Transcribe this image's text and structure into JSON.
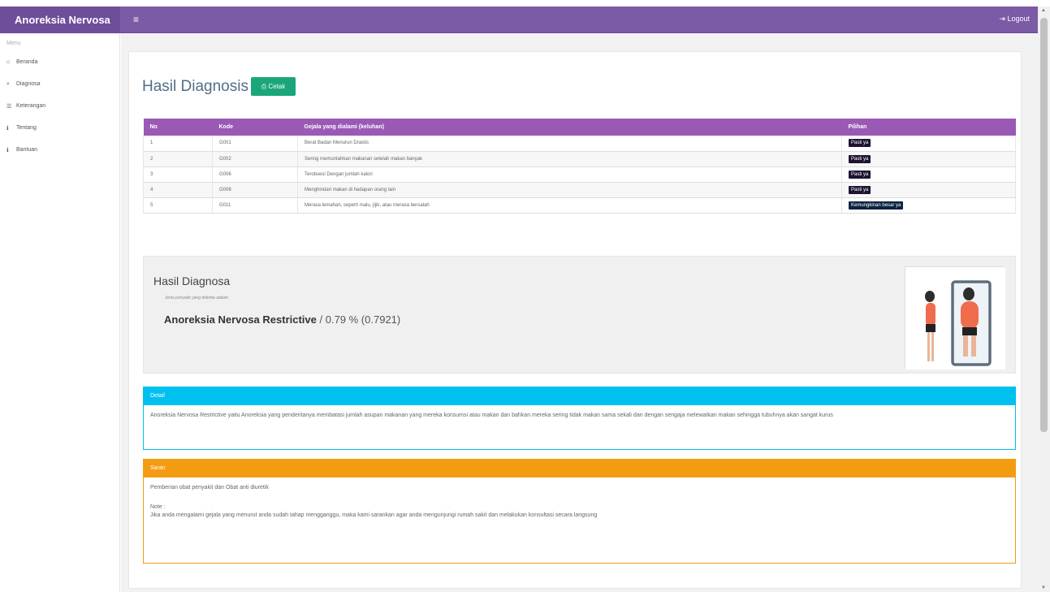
{
  "topbar": {
    "brand": "Anoreksia Nervosa",
    "menu_icon": "hamburger-icon",
    "logout_label": "Logout"
  },
  "sidebar": {
    "header": "Menu",
    "items": [
      {
        "icon": "home-icon",
        "label": "Beranda"
      },
      {
        "icon": "search-icon",
        "label": "Diagnosa"
      },
      {
        "icon": "list-icon",
        "label": "Keterangan"
      },
      {
        "icon": "info-icon",
        "label": "Tentang"
      },
      {
        "icon": "info-icon",
        "label": "Bantuan"
      }
    ]
  },
  "main": {
    "title": "Hasil Diagnosis",
    "print_label": "Cetak",
    "table": {
      "headers": [
        "No",
        "Kode",
        "Gejala yang dialami (keluhan)",
        "Pilihan"
      ],
      "rows": [
        {
          "no": "1",
          "kode": "G001",
          "gejala": "Berat Badan Menurun Drastis",
          "pilihan": "Pasti ya"
        },
        {
          "no": "2",
          "kode": "G002",
          "gejala": "Sering memuntahkan makanan setelah makan banyak",
          "pilihan": "Pasti ya"
        },
        {
          "no": "3",
          "kode": "G006",
          "gejala": "Terobsesi Dengan jumlah kalori",
          "pilihan": "Pasti ya"
        },
        {
          "no": "4",
          "kode": "G008",
          "gejala": "Menghindari makan di hadapan orang lain",
          "pilihan": "Pasti ya"
        },
        {
          "no": "5",
          "kode": "G011",
          "gejala": "Merasa lemahan, seperti malu, jijik, atau merasa bersalah",
          "pilihan": "Kemungkinan besar ya"
        }
      ]
    },
    "result": {
      "heading": "Hasil Diagnosa",
      "subtitle": "Jenis penyakit yang diderita adalah",
      "disease": "Anoreksia Nervosa Restrictive",
      "score": "/ 0.79 % (0.7921)"
    },
    "detail": {
      "heading": "Detail",
      "text": "Anoreksia Nervosa Restrictive yaitu Anoreksia yang penderitanya membatasi jumlah asupan makanan yang mereka konsumsi atau makan dan bahkan mereka sering tidak makan sama sekali dan dengan sengaja melewatkan makan sehingga tubuhnya akan sangat kurus"
    },
    "saran": {
      "heading": "Saran",
      "text": "Pemberian obat penyakit dan Obat anti diuretik",
      "note_label": "Note :",
      "note": "Jika anda mengalami gejala yang menurut anda sudah tahap mengganggu, maka kami sarankan agar anda mengunjungi rumah sakit dan melakukan konsultasi secara langsung"
    }
  },
  "colors": {
    "topbar": "#7b5aa6",
    "table_header": "#9b59b6",
    "print_button": "#1aa67a",
    "detail": "#00c0ef",
    "saran": "#f39c12"
  }
}
